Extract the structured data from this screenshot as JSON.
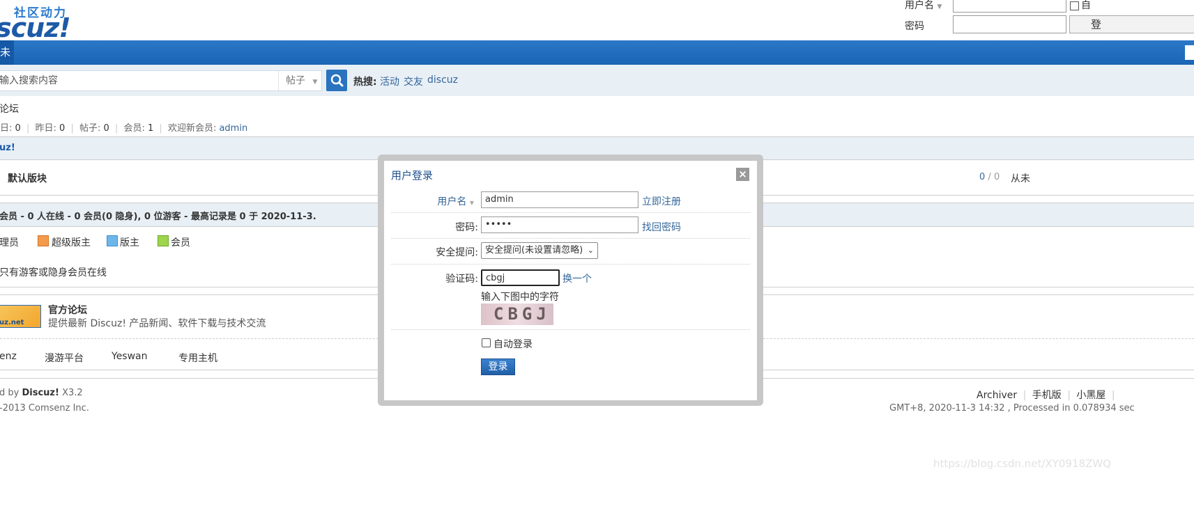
{
  "header": {
    "logo_cn": "社区动力",
    "logo_main": "scuz!",
    "username_label": "用户名",
    "password_label": "密码",
    "login_btn_fragment": "登",
    "autologin_fragment": "自"
  },
  "nav": {
    "tab_fragment": "未"
  },
  "search": {
    "placeholder": "输入搜索内容",
    "type": "帖子",
    "hot_label": "热搜:",
    "hot_items": [
      "活动",
      "交友",
      "discuz"
    ]
  },
  "forum": {
    "title_fragment": "论坛",
    "stats": [
      {
        "label": "日:",
        "value": "0"
      },
      {
        "label": "昨日:",
        "value": "0"
      },
      {
        "label": "帖子:",
        "value": "0"
      },
      {
        "label": "会员:",
        "value": "1"
      }
    ],
    "welcome_label": "欢迎新会员:",
    "welcome_user": "admin",
    "category": "uz!",
    "board_name": "默认版块",
    "board_counts": "0",
    "board_counts2": "0",
    "board_last": "从未"
  },
  "online": {
    "summary": "会员 - 0 人在线 - 0 会员(0 隐身), 0 位游客 - 最高记录是 0 于 2020-11-3.",
    "legend": [
      "理员",
      "超级版主",
      "版主",
      "会员"
    ],
    "note": "只有游客或隐身会员在线"
  },
  "links": {
    "official_title": "官方论坛",
    "official_desc": "提供最新 Discuz! 产品新闻、软件下载与技术交流",
    "logo_text": "uz.net",
    "text_links": [
      "enz",
      "漫游平台",
      "Yeswan",
      "专用主机"
    ]
  },
  "footer": {
    "powered_prefix": "d by",
    "powered_brand": "Discuz!",
    "powered_ver": "X3.2",
    "copyright": "-2013 Comsenz Inc.",
    "links": [
      "Archiver",
      "手机版",
      "小黑屋"
    ],
    "time": "GMT+8, 2020-11-3 14:32 , Processed in 0.078934 sec"
  },
  "dialog": {
    "title": "用户登录",
    "close": "×",
    "username_label": "用户名",
    "username_value": "admin",
    "register_link": "立即注册",
    "password_label": "密码:",
    "password_value": "•••••",
    "forgot_link": "找回密码",
    "question_label": "安全提问:",
    "question_value": "安全提问(未设置请忽略)",
    "captcha_label": "验证码:",
    "captcha_value": "cbgj",
    "captcha_refresh": "换一个",
    "captcha_hint": "输入下图中的字符",
    "captcha_image_text": "CBGJ",
    "autologin_label": "自动登录",
    "submit_label": "登录"
  },
  "watermark": "https://blog.csdn.net/XY0918ZWQ"
}
